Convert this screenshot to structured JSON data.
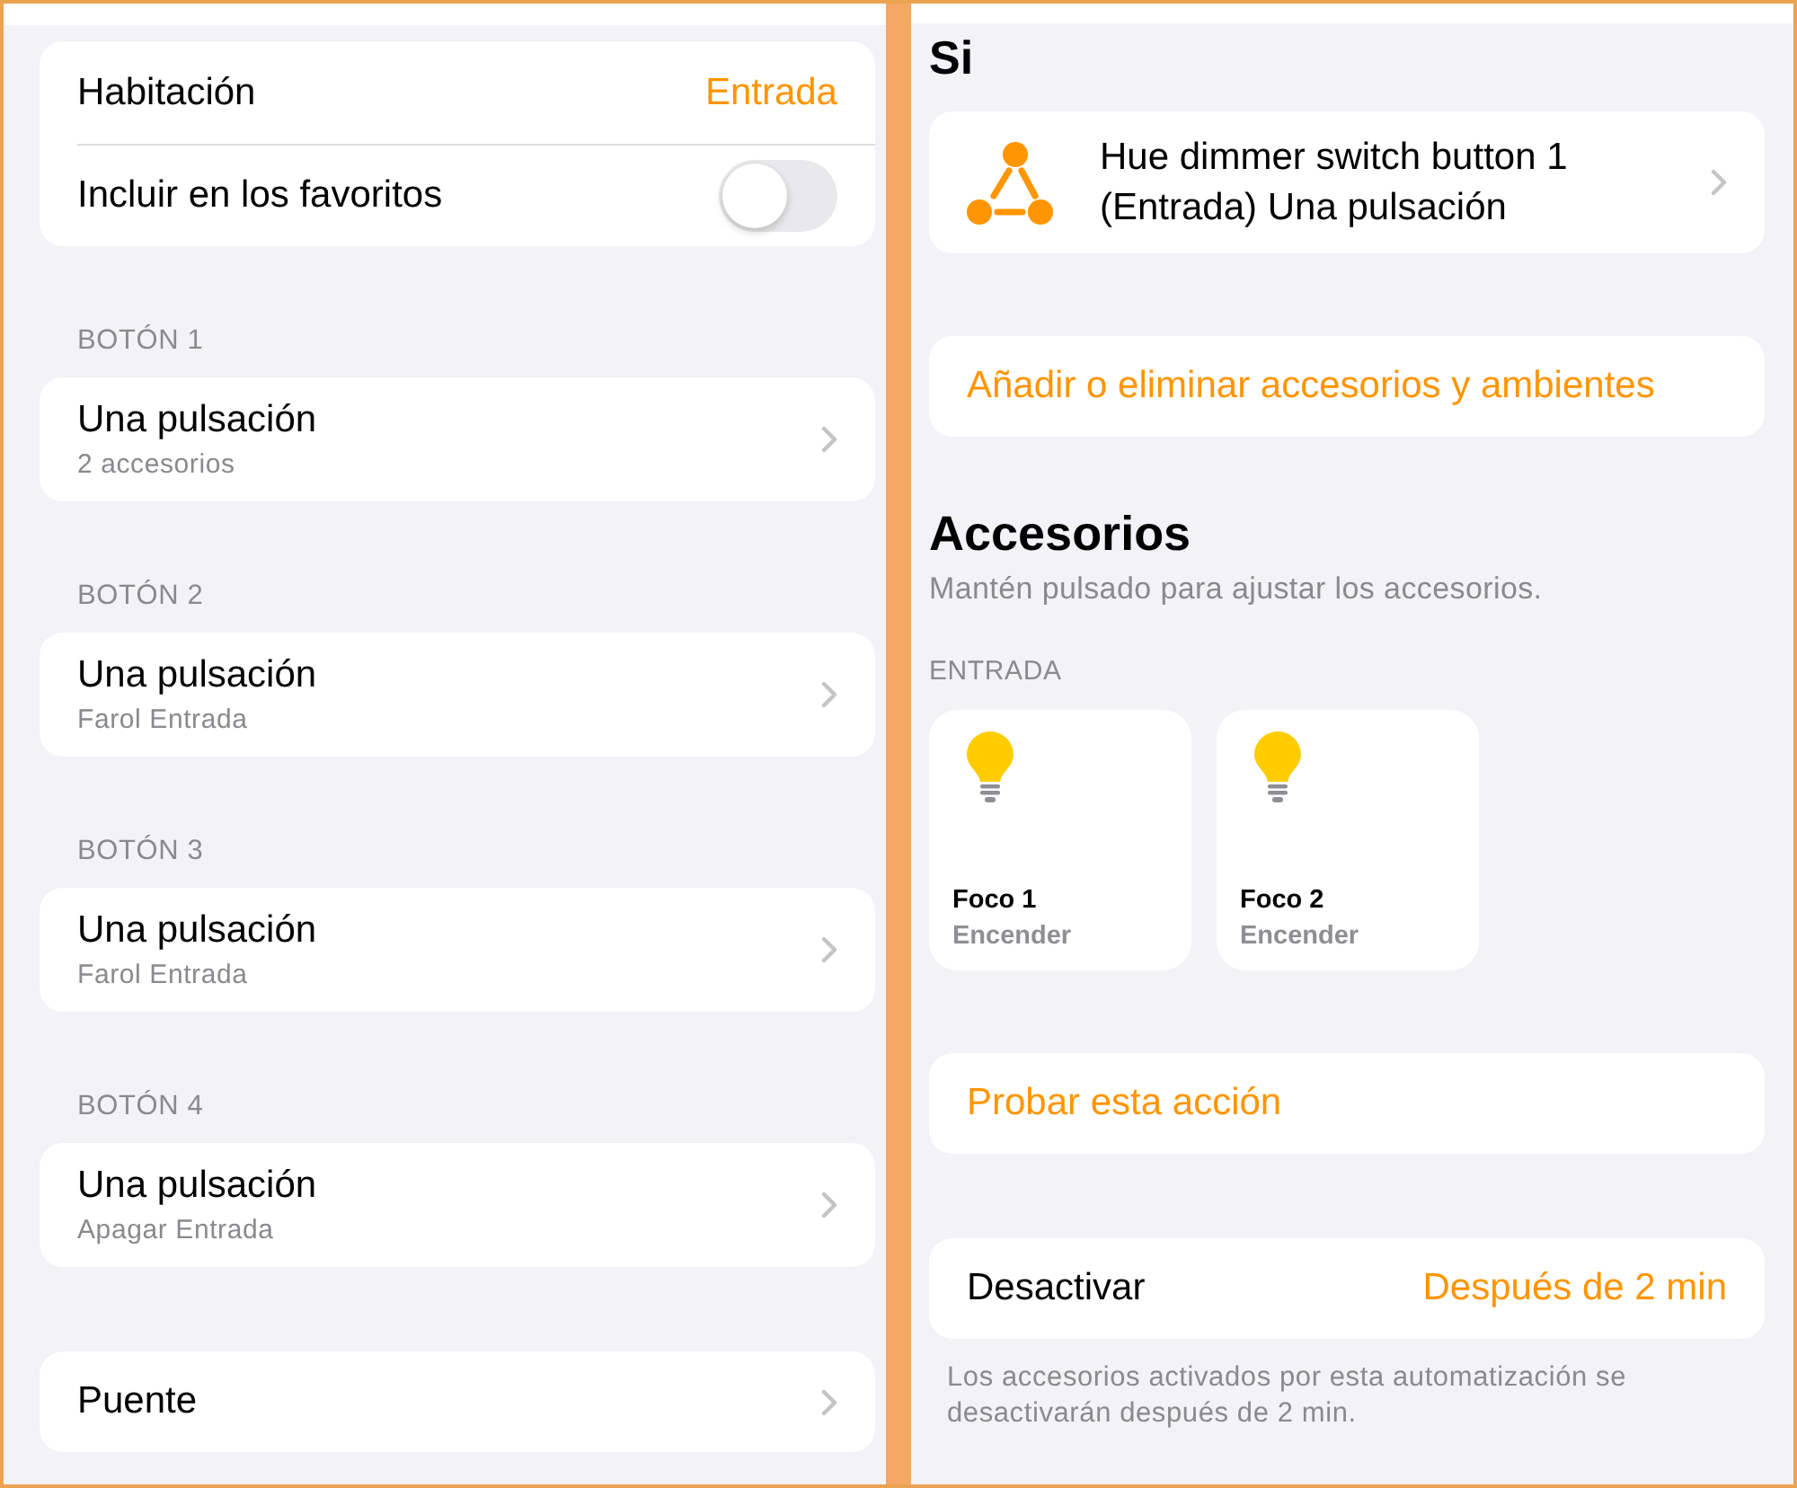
{
  "left_panel": {
    "settings": [
      {
        "kind": "value",
        "label": "Habitación",
        "value": "Entrada"
      },
      {
        "kind": "toggle",
        "label": "Incluir en los favoritos",
        "on": false
      }
    ],
    "button_sections": [
      {
        "header": "BOTÓN 1",
        "title": "Una pulsación",
        "subtitle": "2 accesorios"
      },
      {
        "header": "BOTÓN 2",
        "title": "Una pulsación",
        "subtitle": "Farol Entrada"
      },
      {
        "header": "BOTÓN 3",
        "title": "Una pulsación",
        "subtitle": "Farol Entrada"
      },
      {
        "header": "BOTÓN 4",
        "title": "Una pulsación",
        "subtitle": "Apagar Entrada"
      }
    ],
    "bridge": {
      "label": "Puente"
    }
  },
  "right_panel": {
    "if_section": {
      "title": "Si",
      "trigger": "Hue dimmer switch button 1 (Entrada) Una pulsación"
    },
    "add_remove_button": "Añadir o eliminar accesorios y ambientes",
    "accessories": {
      "title": "Accesorios",
      "subtitle": "Mantén pulsado para ajustar los accesorios.",
      "room_header": "ENTRADA",
      "tiles": [
        {
          "name": "Foco 1",
          "action": "Encender"
        },
        {
          "name": "Foco 2",
          "action": "Encender"
        }
      ]
    },
    "test_action_button": "Probar esta acción",
    "deactivate": {
      "label": "Desactivar",
      "value": "Después de 2 min"
    },
    "footnote": "Los accesorios activados por esta automatización se desactivarán después de 2 min."
  }
}
